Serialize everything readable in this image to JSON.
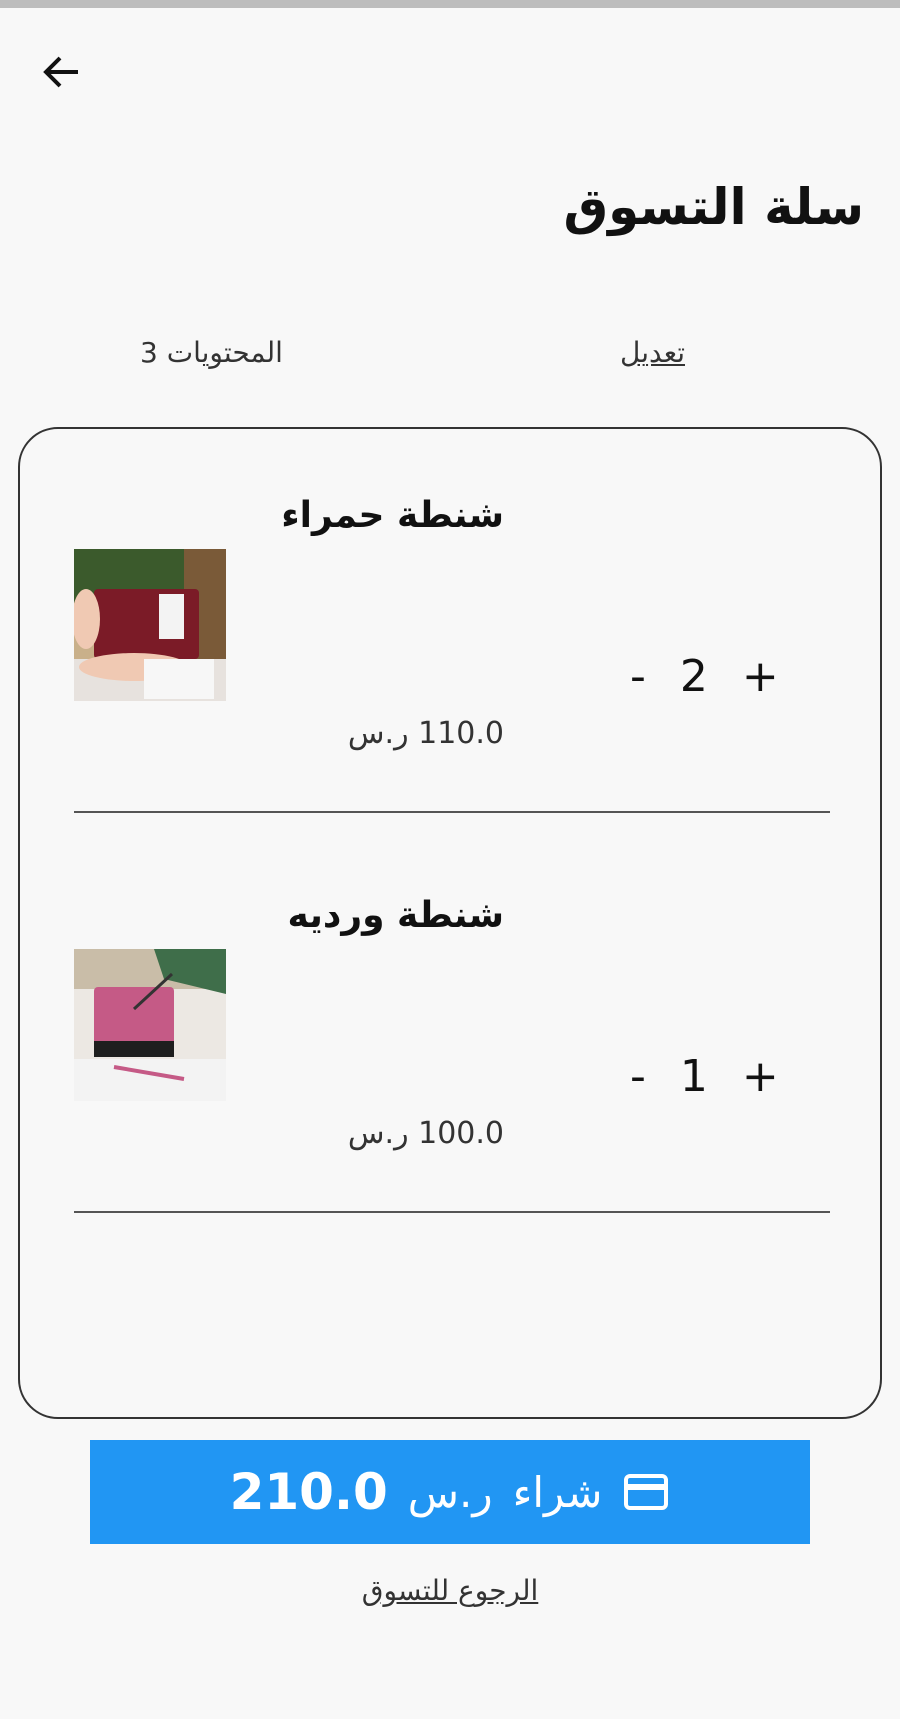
{
  "header": {
    "back_label": "",
    "title": "سلة التسوق"
  },
  "toolbar": {
    "edit_label": "تعديل",
    "contents_label": "المحتويات 3"
  },
  "cart": {
    "items": [
      {
        "name": "شنطة حمراء",
        "price": "110.0 ر.س",
        "quantity": "2",
        "minus": "-",
        "plus": "+"
      },
      {
        "name": "شنطة ورديه",
        "price": "100.0 ر.س",
        "quantity": "1",
        "minus": "-",
        "plus": "+"
      }
    ]
  },
  "checkout": {
    "total": "210.0",
    "currency": "ر.س",
    "buy_label": "شراء",
    "back_to_shopping": "الرجوع للتسوق"
  },
  "colors": {
    "accent": "#2196f3"
  }
}
